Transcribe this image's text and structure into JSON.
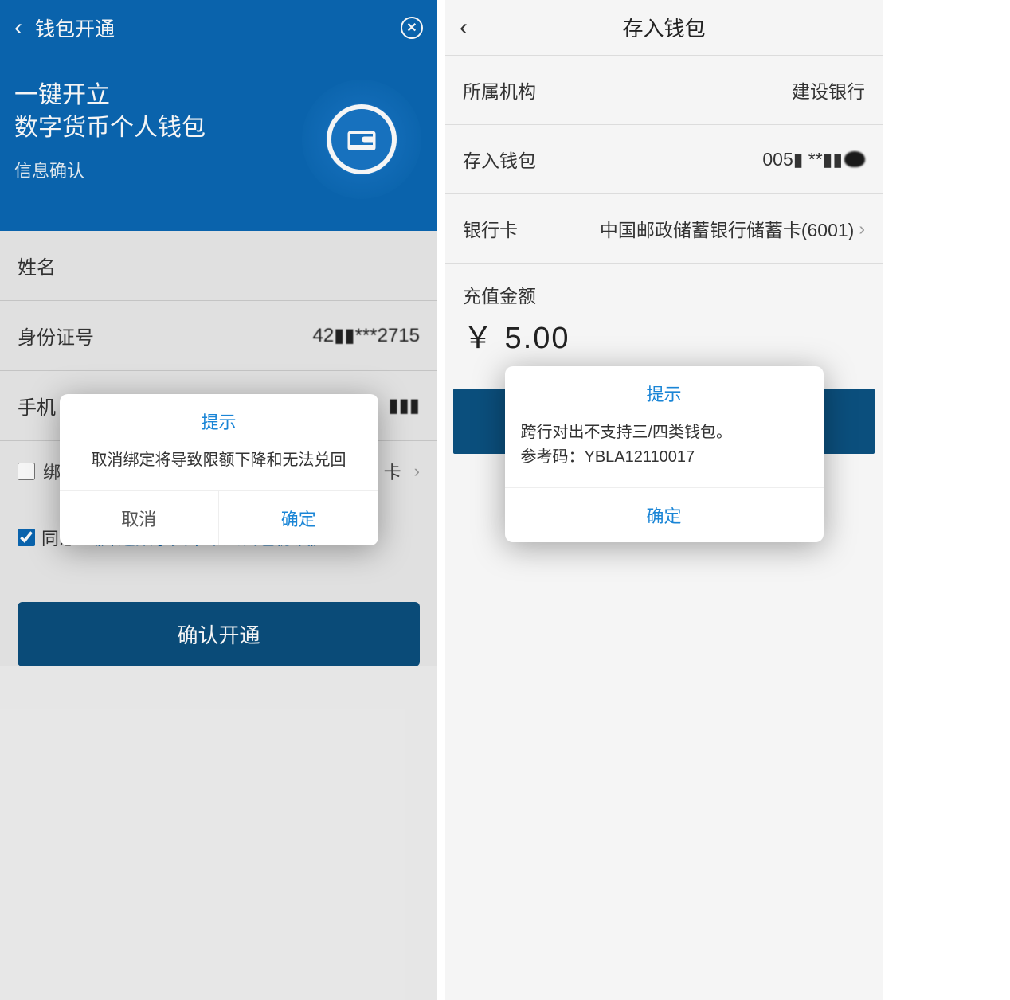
{
  "left": {
    "header": {
      "title": "钱包开通"
    },
    "hero": {
      "line1": "一键开立",
      "line2": "数字货币个人钱包",
      "sub": "信息确认"
    },
    "form": {
      "name_label": "姓名",
      "id_label": "身份证号",
      "id_value": "42▮▮***2715",
      "phone_label": "手机",
      "phone_value": "▮▮▮",
      "bind_prefix": "绑",
      "bind_suffix": "卡",
      "agree_text": "同意",
      "agreement_link": "《开通数字货币个人钱包协议》",
      "confirm_btn": "确认开通"
    },
    "dialog": {
      "title": "提示",
      "message": "取消绑定将导致限额下降和无法兑回",
      "cancel": "取消",
      "ok": "确定"
    }
  },
  "right": {
    "header": {
      "title": "存入钱包"
    },
    "rows": {
      "org_label": "所属机构",
      "org_value": "建设银行",
      "wallet_label": "存入钱包",
      "wallet_value": "005▮ **▮▮",
      "card_label": "银行卡",
      "card_value": "中国邮政储蓄银行储蓄卡(6001)"
    },
    "amount_label": "充值金额",
    "amount_value": "￥ 5.00",
    "dialog": {
      "title": "提示",
      "msg_line1": "跨行对出不支持三/四类钱包。",
      "msg_line2": "参考码：YBLA12110017",
      "ok": "确定"
    }
  }
}
